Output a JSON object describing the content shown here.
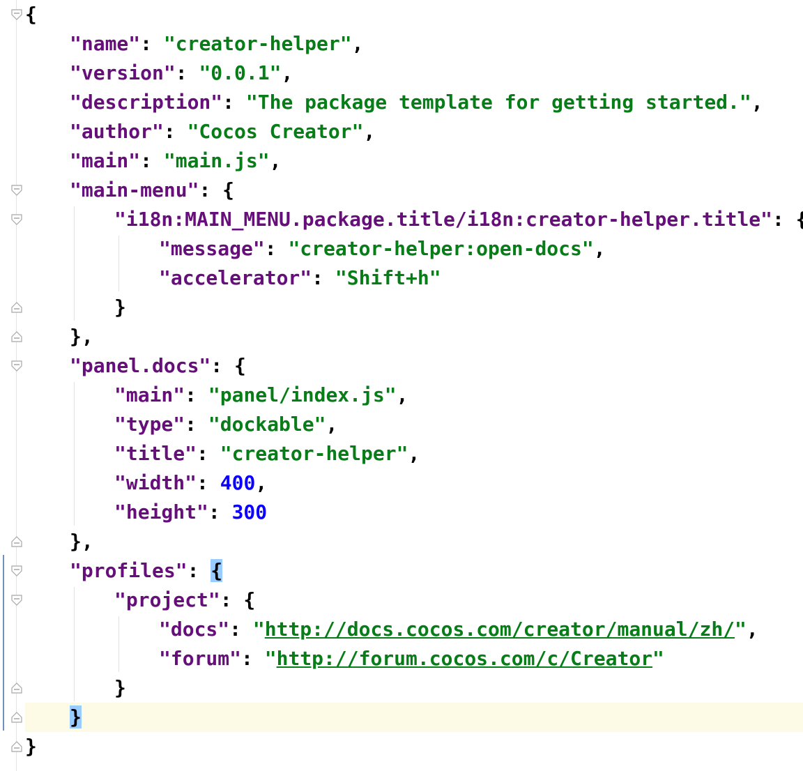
{
  "editor": {
    "lines": [
      {
        "indent": 0,
        "tokens": [
          {
            "t": "{",
            "c": "punc"
          }
        ]
      },
      {
        "indent": 1,
        "tokens": [
          {
            "t": "\"name\"",
            "c": "key"
          },
          {
            "t": ": ",
            "c": "punc"
          },
          {
            "t": "\"creator-helper\"",
            "c": "str"
          },
          {
            "t": ",",
            "c": "punc"
          }
        ]
      },
      {
        "indent": 1,
        "tokens": [
          {
            "t": "\"version\"",
            "c": "key"
          },
          {
            "t": ": ",
            "c": "punc"
          },
          {
            "t": "\"0.0.1\"",
            "c": "str"
          },
          {
            "t": ",",
            "c": "punc"
          }
        ]
      },
      {
        "indent": 1,
        "tokens": [
          {
            "t": "\"description\"",
            "c": "key"
          },
          {
            "t": ": ",
            "c": "punc"
          },
          {
            "t": "\"The package template for getting started.\"",
            "c": "str"
          },
          {
            "t": ",",
            "c": "punc"
          }
        ]
      },
      {
        "indent": 1,
        "tokens": [
          {
            "t": "\"author\"",
            "c": "key"
          },
          {
            "t": ": ",
            "c": "punc"
          },
          {
            "t": "\"Cocos Creator\"",
            "c": "str"
          },
          {
            "t": ",",
            "c": "punc"
          }
        ]
      },
      {
        "indent": 1,
        "tokens": [
          {
            "t": "\"main\"",
            "c": "key"
          },
          {
            "t": ": ",
            "c": "punc"
          },
          {
            "t": "\"main.js\"",
            "c": "str"
          },
          {
            "t": ",",
            "c": "punc"
          }
        ]
      },
      {
        "indent": 1,
        "tokens": [
          {
            "t": "\"main-menu\"",
            "c": "key"
          },
          {
            "t": ": {",
            "c": "punc"
          }
        ]
      },
      {
        "indent": 2,
        "tokens": [
          {
            "t": "\"i18n:MAIN_MENU.package.title/i18n:creator-helper.title\"",
            "c": "key"
          },
          {
            "t": ": {",
            "c": "punc"
          }
        ]
      },
      {
        "indent": 3,
        "tokens": [
          {
            "t": "\"message\"",
            "c": "key"
          },
          {
            "t": ": ",
            "c": "punc"
          },
          {
            "t": "\"creator-helper:open-docs\"",
            "c": "str"
          },
          {
            "t": ",",
            "c": "punc"
          }
        ]
      },
      {
        "indent": 3,
        "tokens": [
          {
            "t": "\"accelerator\"",
            "c": "key"
          },
          {
            "t": ": ",
            "c": "punc"
          },
          {
            "t": "\"Shift+h\"",
            "c": "str"
          }
        ]
      },
      {
        "indent": 2,
        "tokens": [
          {
            "t": "}",
            "c": "punc"
          }
        ]
      },
      {
        "indent": 1,
        "tokens": [
          {
            "t": "},",
            "c": "punc"
          }
        ]
      },
      {
        "indent": 1,
        "tokens": [
          {
            "t": "\"panel.docs\"",
            "c": "key"
          },
          {
            "t": ": {",
            "c": "punc"
          }
        ]
      },
      {
        "indent": 2,
        "tokens": [
          {
            "t": "\"main\"",
            "c": "key"
          },
          {
            "t": ": ",
            "c": "punc"
          },
          {
            "t": "\"panel/index.js\"",
            "c": "str"
          },
          {
            "t": ",",
            "c": "punc"
          }
        ]
      },
      {
        "indent": 2,
        "tokens": [
          {
            "t": "\"type\"",
            "c": "key"
          },
          {
            "t": ": ",
            "c": "punc"
          },
          {
            "t": "\"dockable\"",
            "c": "str"
          },
          {
            "t": ",",
            "c": "punc"
          }
        ]
      },
      {
        "indent": 2,
        "tokens": [
          {
            "t": "\"title\"",
            "c": "key"
          },
          {
            "t": ": ",
            "c": "punc"
          },
          {
            "t": "\"creator-helper\"",
            "c": "str"
          },
          {
            "t": ",",
            "c": "punc"
          }
        ]
      },
      {
        "indent": 2,
        "tokens": [
          {
            "t": "\"width\"",
            "c": "key"
          },
          {
            "t": ": ",
            "c": "punc"
          },
          {
            "t": "400",
            "c": "num"
          },
          {
            "t": ",",
            "c": "punc"
          }
        ]
      },
      {
        "indent": 2,
        "tokens": [
          {
            "t": "\"height\"",
            "c": "key"
          },
          {
            "t": ": ",
            "c": "punc"
          },
          {
            "t": "300",
            "c": "num"
          }
        ]
      },
      {
        "indent": 1,
        "tokens": [
          {
            "t": "},",
            "c": "punc"
          }
        ]
      },
      {
        "indent": 1,
        "tokens": [
          {
            "t": "\"profiles\"",
            "c": "key"
          },
          {
            "t": ": ",
            "c": "punc"
          },
          {
            "t": "{",
            "c": "punc",
            "hl": true
          }
        ]
      },
      {
        "indent": 2,
        "tokens": [
          {
            "t": "\"project\"",
            "c": "key"
          },
          {
            "t": ": {",
            "c": "punc"
          }
        ]
      },
      {
        "indent": 3,
        "tokens": [
          {
            "t": "\"docs\"",
            "c": "key"
          },
          {
            "t": ": ",
            "c": "punc"
          },
          {
            "t": "\"",
            "c": "str"
          },
          {
            "t": "http://docs.cocos.com/creator/manual/zh/",
            "c": "url"
          },
          {
            "t": "\"",
            "c": "str"
          },
          {
            "t": ",",
            "c": "punc"
          }
        ]
      },
      {
        "indent": 3,
        "tokens": [
          {
            "t": "\"forum\"",
            "c": "key"
          },
          {
            "t": ": ",
            "c": "punc"
          },
          {
            "t": "\"",
            "c": "str"
          },
          {
            "t": "http://forum.cocos.com/c/Creator",
            "c": "url"
          },
          {
            "t": "\"",
            "c": "str"
          }
        ]
      },
      {
        "indent": 2,
        "tokens": [
          {
            "t": "}",
            "c": "punc"
          }
        ]
      },
      {
        "indent": 1,
        "tokens": [
          {
            "t": "}",
            "c": "punc",
            "hl": true
          }
        ]
      },
      {
        "indent": 0,
        "tokens": [
          {
            "t": "}",
            "c": "punc"
          }
        ]
      }
    ],
    "folds": [
      {
        "line": 0,
        "dir": "open"
      },
      {
        "line": 6,
        "dir": "open"
      },
      {
        "line": 7,
        "dir": "open"
      },
      {
        "line": 10,
        "dir": "close"
      },
      {
        "line": 11,
        "dir": "close"
      },
      {
        "line": 12,
        "dir": "open"
      },
      {
        "line": 18,
        "dir": "close"
      },
      {
        "line": 19,
        "dir": "open"
      },
      {
        "line": 20,
        "dir": "open"
      },
      {
        "line": 23,
        "dir": "close"
      },
      {
        "line": 24,
        "dir": "close"
      },
      {
        "line": 25,
        "dir": "close"
      }
    ],
    "guides": [
      {
        "level": 1,
        "from": 7,
        "to": 10
      },
      {
        "level": 2,
        "from": 8,
        "to": 9
      },
      {
        "level": 1,
        "from": 13,
        "to": 17
      },
      {
        "level": 1,
        "from": 20,
        "to": 23
      },
      {
        "level": 2,
        "from": 21,
        "to": 22
      }
    ],
    "current_line": 24,
    "colors": {
      "key": "#660e7a",
      "string": "#067d17",
      "number": "#0b00ff",
      "punctuation": "#000000",
      "brace_highlight": "#99ccff",
      "current_line": "#fdfbe6"
    }
  }
}
